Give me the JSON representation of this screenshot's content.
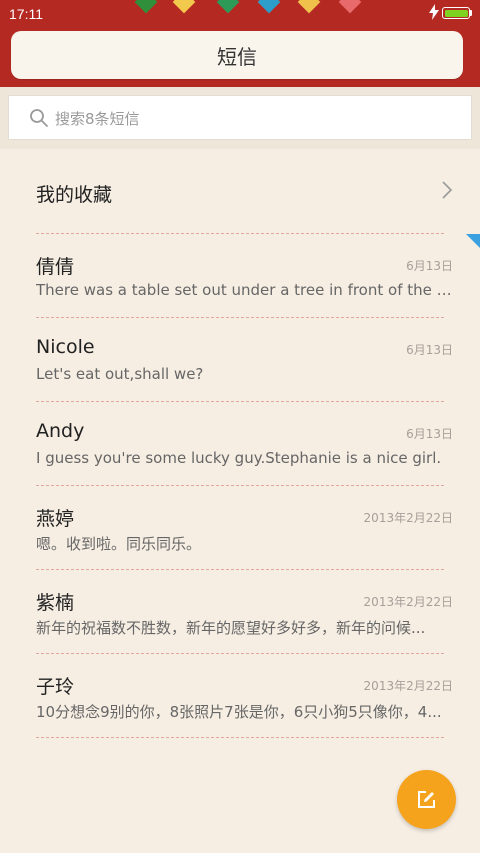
{
  "status_bar": {
    "time": "17:11",
    "battery_color": "#7ed321",
    "icons": [
      "charging-bolt-icon",
      "battery-icon"
    ]
  },
  "header": {
    "title": "短信",
    "background_color": "#b42a23"
  },
  "search": {
    "placeholder": "搜索8条短信",
    "icon": "search-icon"
  },
  "favorites": {
    "label": "我的收藏",
    "icon": "chevron-right-icon"
  },
  "conversations": [
    {
      "name": "倩倩",
      "date": "6月13日",
      "preview": "There was a table set out under a tree in front of the ho.."
    },
    {
      "name": "Nicole",
      "date": "6月13日",
      "preview": "Let's eat out,shall we?"
    },
    {
      "name": "Andy",
      "date": "6月13日",
      "preview": "I guess you're some lucky guy.Stephanie is a nice girl."
    },
    {
      "name": "燕婷",
      "date": "2013年2月22日",
      "preview": "嗯。收到啦。同乐同乐。"
    },
    {
      "name": "紫楠",
      "date": "2013年2月22日",
      "preview": "新年的祝福数不胜数，新年的愿望好多好多，新年的问候..."
    },
    {
      "name": "子玲",
      "date": "2013年2月22日",
      "preview": "10分想念9别的你，8张照片7张是你，6只小狗5只像你，4..."
    }
  ],
  "compose_button": {
    "icon": "compose-icon",
    "color": "#f5a31d"
  }
}
